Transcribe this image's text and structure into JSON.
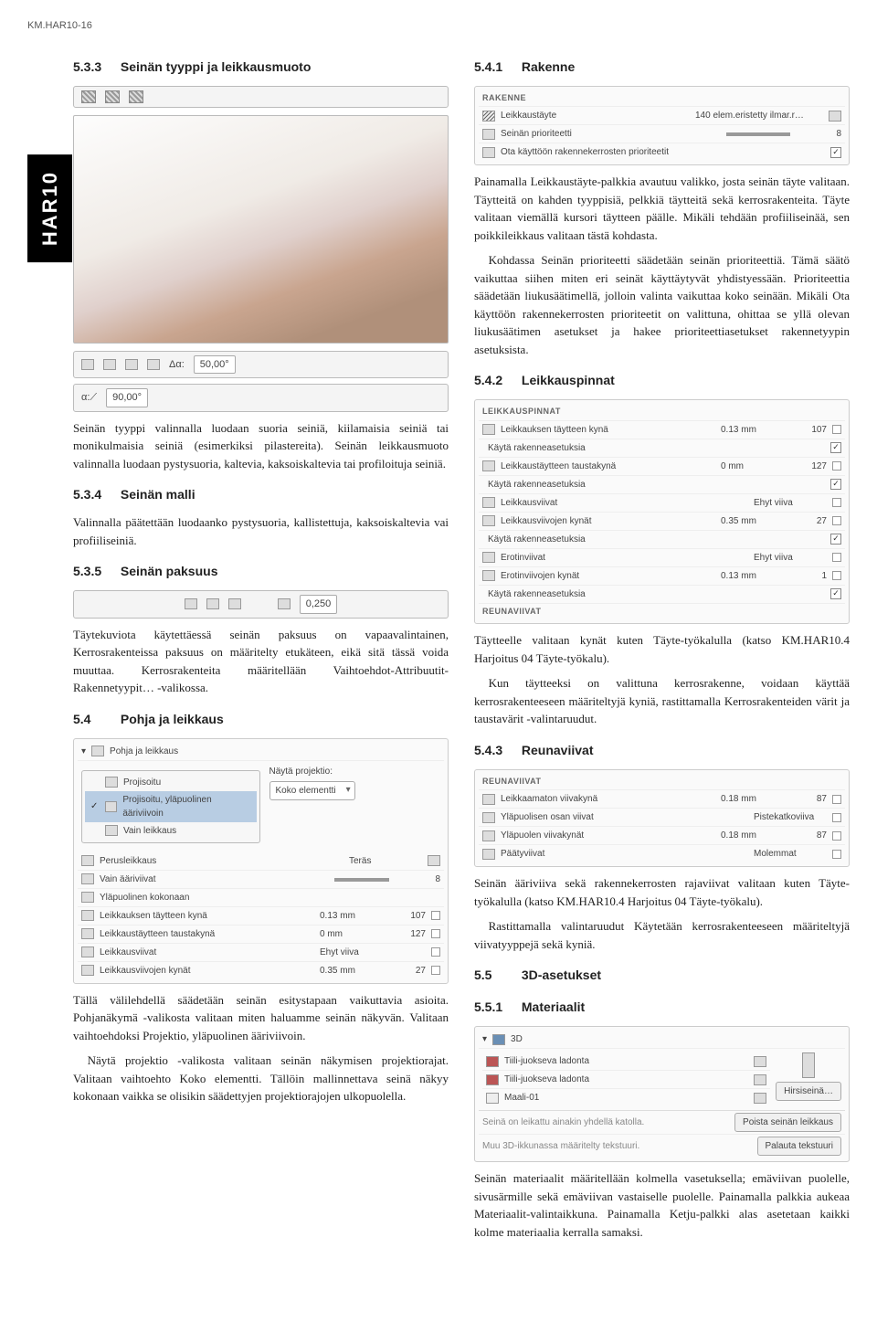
{
  "header": "KM.HAR10-16",
  "sidebar_tab": "HAR10",
  "left": {
    "sec533": {
      "num": "5.3.3",
      "title": "Seinän tyyppi ja leikkausmuoto"
    },
    "angle_bar": {
      "a1": "50,00°",
      "a2": "90,00°"
    },
    "p_seinatyyppi": "Seinän tyyppi valinnalla luodaan suoria seiniä, kiilamaisia seiniä tai monikulmaisia seiniä (esimerkiksi pilastereita). Seinän leikkausmuoto valinnalla luodaan pystysuoria, kaltevia, kaksoiskaltevia tai profiloituja seiniä.",
    "sec534": {
      "num": "5.3.4",
      "title": "Seinän malli"
    },
    "p_534": "Valinnalla päätettään luodaanko pystysuoria, kallistettuja, kaksoiskaltevia vai profiiliseiniä.",
    "sec535": {
      "num": "5.3.5",
      "title": "Seinän paksuus"
    },
    "paksuus_bar": {
      "val": "0,250"
    },
    "p_535": "Täytekuviota käytettäessä seinän paksuus on vapaavalintainen, Kerrosrakenteissa paksuus on määritelty etukäteen, eikä sitä tässä voida muuttaa. Kerrosrakenteita määritellään Vaihtoehdot-Attribuutit-Rakennetyypit… -valikossa.",
    "sec54": {
      "num": "5.4",
      "title": "Pohja ja leikkaus"
    },
    "pohja_panel": {
      "title": "Pohja ja leikkaus",
      "proj_label": "Näytä projektio:",
      "proj_value": "Koko elementti",
      "menu": {
        "i1": "Projisoitu",
        "i2": "Projisoitu, yläpuolinen ääriviivoin",
        "i3": "Vain leikkaus"
      },
      "perus": "Perusleikkaus",
      "teras": "Teräs",
      "vainaari": "Vain ääriviivat",
      "ylap": "Yläpuolinen kokonaan",
      "rows": [
        {
          "label": "Leikkauksen täytteen kynä",
          "val": "0.13 mm",
          "num": "107"
        },
        {
          "label": "Leikkaustäytteen taustakynä",
          "val": "0 mm",
          "num": "127"
        },
        {
          "label": "Leikkausviivat",
          "val": "Ehyt viiva",
          "num": ""
        },
        {
          "label": "Leikkausviivojen kynät",
          "val": "0.35 mm",
          "num": "27"
        }
      ]
    },
    "p_54a": "Tällä välilehdellä säädetään seinän esitystapaan vaikuttavia asioita. Pohjanäkymä -valikosta valitaan miten haluamme seinän näkyvän. Valitaan vaihtoehdoksi Projektio, yläpuolinen ääriviivoin.",
    "p_54b": "Näytä projektio -valikosta valitaan seinän näkymisen projektiorajat. Valitaan vaihtoehto Koko elementti. Tällöin mallinnettava seinä näkyy kokonaan vaikka se olisikin säädettyjen projektiorajojen ulkopuolella."
  },
  "right": {
    "sec541": {
      "num": "5.4.1",
      "title": "Rakenne"
    },
    "rakenne_panel": {
      "title": "RAKENNE",
      "r1": {
        "label": "Leikkaustäyte",
        "val": "140 elem.eristetty ilmar.r…"
      },
      "r2": {
        "label": "Seinän prioriteetti",
        "num": "8"
      },
      "r3": {
        "label": "Ota käyttöön rakennekerrosten prioriteetit"
      }
    },
    "p_541a": "Painamalla Leikkaustäyte-palkkia avautuu valikko, josta seinän täyte valitaan. Täytteitä on kahden tyyppisiä, pelkkiä täytteitä sekä kerrosrakenteita. Täyte valitaan viemällä kursori täytteen päälle. Mikäli tehdään profiiliseinää, sen poikkileikkaus valitaan tästä kohdasta.",
    "p_541b": "Kohdassa Seinän prioriteetti säädetään seinän prioriteettiä. Tämä säätö vaikuttaa siihen miten eri seinät käyttäytyvät yhdistyessään. Prioriteettia säädetään liukusäätimellä, jolloin valinta vaikuttaa koko seinään. Mikäli Ota käyttöön rakennekerrosten prioriteetit on valittuna, ohittaa se yllä olevan liukusäätimen asetukset ja hakee prioriteettiasetukset rakennetyypin asetuksista.",
    "sec542": {
      "num": "5.4.2",
      "title": "Leikkauspinnat"
    },
    "leikkauspinnat_panel": {
      "title": "LEIKKAUSPINNAT",
      "rows": [
        {
          "label": "Leikkauksen täytteen kynä",
          "val": "0.13 mm",
          "num": "107"
        },
        {
          "label": "Käytä rakenneasetuksia",
          "check": true
        },
        {
          "label": "Leikkaustäytteen taustakynä",
          "val": "0 mm",
          "num": "127"
        },
        {
          "label": "Käytä rakenneasetuksia",
          "check": true
        },
        {
          "label": "Leikkausviivat",
          "val": "Ehyt viiva"
        },
        {
          "label": "Leikkausviivojen kynät",
          "val": "0.35 mm",
          "num": "27"
        },
        {
          "label": "Käytä rakenneasetuksia",
          "check": true
        },
        {
          "label": "Erotinviivat",
          "val": "Ehyt viiva"
        },
        {
          "label": "Erotinviivojen kynät",
          "val": "0.13 mm",
          "num": "1"
        },
        {
          "label": "Käytä rakenneasetuksia",
          "check": true
        }
      ],
      "reuna": "REUNAVIIVAT"
    },
    "p_542": "Täytteelle valitaan kynät kuten Täyte-työkalulla (katso KM.HAR10.4 Harjoitus 04 Täyte-työkalu).",
    "p_542b": "Kun täytteeksi on valittuna kerrosrakenne, voidaan käyttää kerrosrakenteeseen määriteltyjä kyniä, rastittamalla Kerrosrakenteiden värit ja taustavärit -valintaruudut.",
    "sec543": {
      "num": "5.4.3",
      "title": "Reunaviivat"
    },
    "reunaviivat_panel": {
      "title": "REUNAVIIVAT",
      "rows": [
        {
          "label": "Leikkaamaton viivakynä",
          "val": "0.18 mm",
          "num": "87"
        },
        {
          "label": "Yläpuolisen osan viivat",
          "val": "Pistekatkoviiva"
        },
        {
          "label": "Yläpuolen viivakynät",
          "val": "0.18 mm",
          "num": "87"
        },
        {
          "label": "Päätyviivat",
          "val": "Molemmat"
        }
      ]
    },
    "p_543a": "Seinän ääriviiva sekä rakennekerrosten rajaviivat valitaan kuten Täyte-työkalulla (katso KM.HAR10.4 Harjoitus 04 Täyte-työkalu).",
    "p_543b": "Rastittamalla valintaruudut Käytetään kerrosrakenteeseen määriteltyjä viivatyyppejä sekä kyniä.",
    "sec55": {
      "num": "5.5",
      "title": "3D-asetukset"
    },
    "sec551": {
      "num": "5.5.1",
      "title": "Materiaalit"
    },
    "mat_panel": {
      "title": "3D",
      "rows": [
        {
          "label": "Tiili-juokseva ladonta"
        },
        {
          "label": "Tiili-juokseva ladonta"
        },
        {
          "label": "Maali-01"
        }
      ],
      "btn": "Hirsiseinä…",
      "note1": "Seinä on leikattu ainakin yhdellä katolla.",
      "btn2": "Poista seinän leikkaus",
      "note2": "Muu 3D-ikkunassa määritelty tekstuuri.",
      "btn3": "Palauta tekstuuri"
    },
    "p_551": "Seinän materiaalit määritellään kolmella vasetuksella; emäviivan puolelle, sivusärmille sekä emäviivan vastaiselle puolelle. Painamalla palkkia aukeaa Materiaalit-valintaikkuna. Painamalla Ketju-palkki alas asetetaan kaikki kolme materiaalia kerralla samaksi."
  }
}
